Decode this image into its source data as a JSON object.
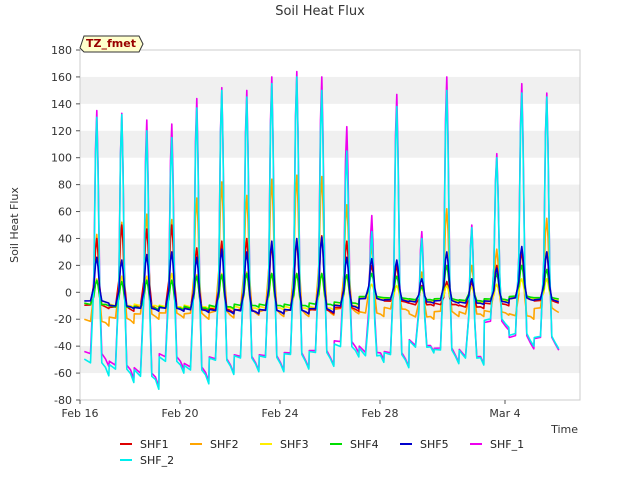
{
  "chart_data": {
    "type": "line",
    "title": "Soil Heat Flux",
    "xlabel": "Time",
    "ylabel": "Soil Heat Flux",
    "ylim": [
      -80,
      180
    ],
    "yticks": [
      -80,
      -60,
      -40,
      -20,
      0,
      20,
      40,
      60,
      80,
      100,
      120,
      140,
      160,
      180
    ],
    "xlim": [
      "2024-02-16",
      "2024-03-07"
    ],
    "xticks": [
      {
        "date": "2024-02-16",
        "label": "Feb 16"
      },
      {
        "date": "2024-02-20",
        "label": "Feb 20"
      },
      {
        "date": "2024-02-24",
        "label": "Feb 24"
      },
      {
        "date": "2024-02-28",
        "label": "Feb 28"
      },
      {
        "date": "2024-03-04",
        "label": "Mar 4"
      }
    ],
    "grid": "horizontal alternating bands",
    "annotation": "TZ_fmet",
    "legend_position": "bottom",
    "days": [
      "2024-02-16",
      "2024-02-17",
      "2024-02-18",
      "2024-02-19",
      "2024-02-20",
      "2024-02-21",
      "2024-02-22",
      "2024-02-23",
      "2024-02-24",
      "2024-02-25",
      "2024-02-26",
      "2024-02-27",
      "2024-02-28",
      "2024-02-29",
      "2024-03-01",
      "2024-03-02",
      "2024-03-03",
      "2024-03-04",
      "2024-03-05"
    ],
    "series": [
      {
        "name": "SHF1",
        "color": "#dd0000",
        "daily_peak": [
          40,
          50,
          47,
          50,
          33,
          38,
          40,
          35,
          38,
          42,
          38,
          20,
          20,
          5,
          8,
          8,
          20,
          30,
          30
        ],
        "daily_min": [
          -12,
          -14,
          -13,
          -14,
          -14,
          -15,
          -16,
          -16,
          -16,
          -16,
          -14,
          -6,
          -8,
          -10,
          -10,
          -12,
          -10,
          -6,
          -8
        ]
      },
      {
        "name": "SHF2",
        "color": "#ffa500",
        "daily_peak": [
          43,
          52,
          58,
          54,
          70,
          82,
          72,
          84,
          87,
          86,
          65,
          35,
          20,
          15,
          62,
          20,
          32,
          32,
          55
        ],
        "daily_min": [
          -25,
          -23,
          -20,
          -19,
          -20,
          -19,
          -17,
          -18,
          -18,
          -17,
          -16,
          -18,
          -14,
          -20,
          -18,
          -18,
          -17,
          -20,
          -15
        ]
      },
      {
        "name": "SHF3",
        "color": "#ffee00",
        "daily_peak": [
          10,
          12,
          12,
          14,
          13,
          14,
          15,
          14,
          14,
          14,
          13,
          6,
          5,
          3,
          5,
          4,
          6,
          10,
          10
        ],
        "daily_min": [
          -10,
          -11,
          -11,
          -12,
          -12,
          -13,
          -13,
          -13,
          -13,
          -13,
          -11,
          -5,
          -6,
          -7,
          -7,
          -8,
          -7,
          -5,
          -6
        ]
      },
      {
        "name": "SHF4",
        "color": "#00dd00",
        "daily_peak": [
          9,
          8,
          9,
          9,
          12,
          13,
          14,
          14,
          14,
          14,
          13,
          14,
          12,
          4,
          20,
          10,
          14,
          20,
          17
        ],
        "daily_min": [
          -10,
          -12,
          -13,
          -13,
          -13,
          -12,
          -11,
          -11,
          -11,
          -10,
          -9,
          -4,
          -5,
          -6,
          -6,
          -7,
          -6,
          -4,
          -5
        ]
      },
      {
        "name": "SHF5",
        "color": "#0000cc",
        "daily_peak": [
          26,
          24,
          28,
          30,
          26,
          32,
          30,
          38,
          40,
          41,
          26,
          25,
          24,
          10,
          30,
          10,
          18,
          34,
          30
        ],
        "daily_min": [
          -8,
          -12,
          -14,
          -14,
          -15,
          -16,
          -16,
          -16,
          -16,
          -15,
          -12,
          -6,
          -7,
          -8,
          -8,
          -9,
          -8,
          -6,
          -7
        ]
      },
      {
        "name": "SHF_1",
        "color": "#ee00ee",
        "daily_peak": [
          135,
          133,
          128,
          125,
          144,
          152,
          150,
          160,
          164,
          160,
          123,
          57,
          147,
          45,
          160,
          50,
          103,
          155,
          148
        ],
        "daily_min": [
          -55,
          -64,
          -70,
          -57,
          -66,
          -60,
          -58,
          -58,
          -56,
          -54,
          -45,
          -50,
          -55,
          -44,
          -52,
          -53,
          -28,
          -42,
          -43
        ]
      },
      {
        "name": "SHF_2",
        "color": "#00eeee",
        "daily_peak": [
          130,
          132,
          120,
          115,
          137,
          150,
          145,
          155,
          160,
          150,
          105,
          45,
          138,
          40,
          150,
          48,
          100,
          148,
          145
        ],
        "daily_min": [
          -62,
          -67,
          -72,
          -60,
          -68,
          -61,
          -59,
          -59,
          -57,
          -55,
          -48,
          -52,
          -56,
          -45,
          -53,
          -54,
          -26,
          -40,
          -42
        ]
      }
    ]
  }
}
